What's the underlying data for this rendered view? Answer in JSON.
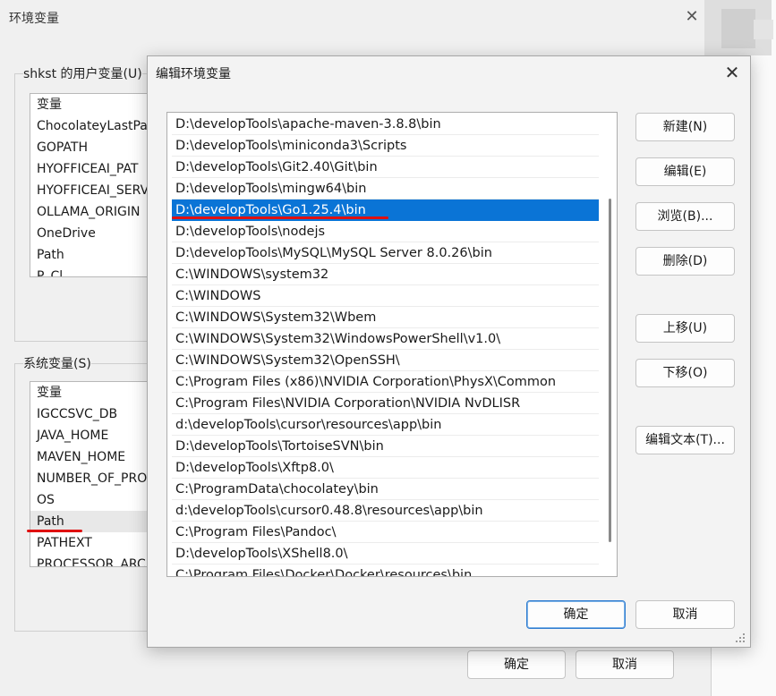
{
  "background_dialog": {
    "title": "环境变量",
    "close_icon": "close-icon",
    "user_vars": {
      "group_label": "shkst 的用户变量(U)",
      "header": "变量",
      "items": [
        "ChocolateyLastPa",
        "GOPATH",
        "HYOFFICEAI_PAT",
        "HYOFFICEAI_SERV",
        "OLLAMA_ORIGIN",
        "OneDrive",
        "Path",
        "P_Cl"
      ]
    },
    "system_vars": {
      "group_label": "系统变量(S)",
      "header": "变量",
      "items": [
        "IGCCSVC_DB",
        "JAVA_HOME",
        "MAVEN_HOME",
        "NUMBER_OF_PRO",
        "OS",
        "Path",
        "PATHEXT",
        "PROCESSOR_ARC"
      ],
      "selected": "Path"
    },
    "ok_label": "确定",
    "cancel_label": "取消"
  },
  "edit_dialog": {
    "title": "编辑环境变量",
    "close_icon": "close-icon",
    "paths": [
      "D:\\developTools\\apache-maven-3.8.8\\bin",
      "D:\\developTools\\miniconda3\\Scripts",
      "D:\\developTools\\Git2.40\\Git\\bin",
      "D:\\developTools\\mingw64\\bin",
      "D:\\developTools\\Go1.25.4\\bin",
      "D:\\developTools\\nodejs",
      "D:\\developTools\\MySQL\\MySQL Server 8.0.26\\bin",
      "C:\\WINDOWS\\system32",
      "C:\\WINDOWS",
      "C:\\WINDOWS\\System32\\Wbem",
      "C:\\WINDOWS\\System32\\WindowsPowerShell\\v1.0\\",
      "C:\\WINDOWS\\System32\\OpenSSH\\",
      "C:\\Program Files (x86)\\NVIDIA Corporation\\PhysX\\Common",
      "C:\\Program Files\\NVIDIA Corporation\\NVIDIA NvDLISR",
      "d:\\developTools\\cursor\\resources\\app\\bin",
      "D:\\developTools\\TortoiseSVN\\bin",
      "D:\\developTools\\Xftp8.0\\",
      "C:\\ProgramData\\chocolatey\\bin",
      "d:\\developTools\\cursor0.48.8\\resources\\app\\bin",
      "C:\\Program Files\\Pandoc\\",
      "D:\\developTools\\XShell8.0\\",
      "C:\\Program Files\\Docker\\Docker\\resources\\bin"
    ],
    "selected_path": "D:\\developTools\\Go1.25.4\\bin",
    "buttons": {
      "new": "新建(N)",
      "edit": "编辑(E)",
      "browse": "浏览(B)...",
      "delete": "删除(D)",
      "move_up": "上移(U)",
      "move_down": "下移(O)",
      "edit_text": "编辑文本(T)..."
    },
    "ok_label": "确定",
    "cancel_label": "取消"
  },
  "colors": {
    "selection": "#0a74d6",
    "annotation_red": "#e01010",
    "primary_border": "#2f7cd0"
  }
}
